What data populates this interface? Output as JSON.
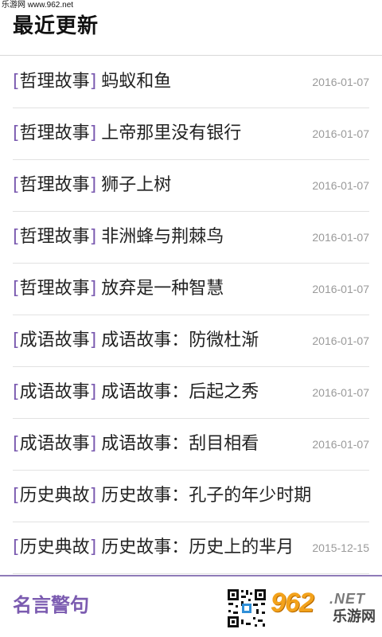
{
  "watermark": "乐游网 www.962.net",
  "header": {
    "title": "最近更新"
  },
  "list": [
    {
      "tag": "哲理故事",
      "title": "蚂蚁和鱼",
      "date": "2016-01-07"
    },
    {
      "tag": "哲理故事",
      "title": "上帝那里没有银行",
      "date": "2016-01-07"
    },
    {
      "tag": "哲理故事",
      "title": "狮子上树",
      "date": "2016-01-07"
    },
    {
      "tag": "哲理故事",
      "title": "非洲蜂与荆棘鸟",
      "date": "2016-01-07"
    },
    {
      "tag": "哲理故事",
      "title": "放弃是一种智慧",
      "date": "2016-01-07"
    },
    {
      "tag": "成语故事",
      "title": "成语故事：防微杜渐",
      "date": "2016-01-07"
    },
    {
      "tag": "成语故事",
      "title": "成语故事：后起之秀",
      "date": "2016-01-07"
    },
    {
      "tag": "成语故事",
      "title": "成语故事：刮目相看",
      "date": "2016-01-07"
    },
    {
      "tag": "历史典故",
      "title": "历史故事：孔子的年少时期",
      "date": ""
    },
    {
      "tag": "历史典故",
      "title": "历史故事：历史上的芈月",
      "date": "2015-12-15"
    }
  ],
  "brackets": {
    "open": "[",
    "close": "]"
  },
  "footer": {
    "tab_label": "名言警句",
    "brand_number": "962",
    "brand_domain": ".NET",
    "brand_name": "乐游网"
  },
  "colors": {
    "accent": "#7b5bb0",
    "footer_border": "#8f7bb8",
    "brand_orange": "#f3a21b",
    "date_gray": "#9a9a9a"
  },
  "icons": {
    "qr": "qr-code-icon"
  }
}
